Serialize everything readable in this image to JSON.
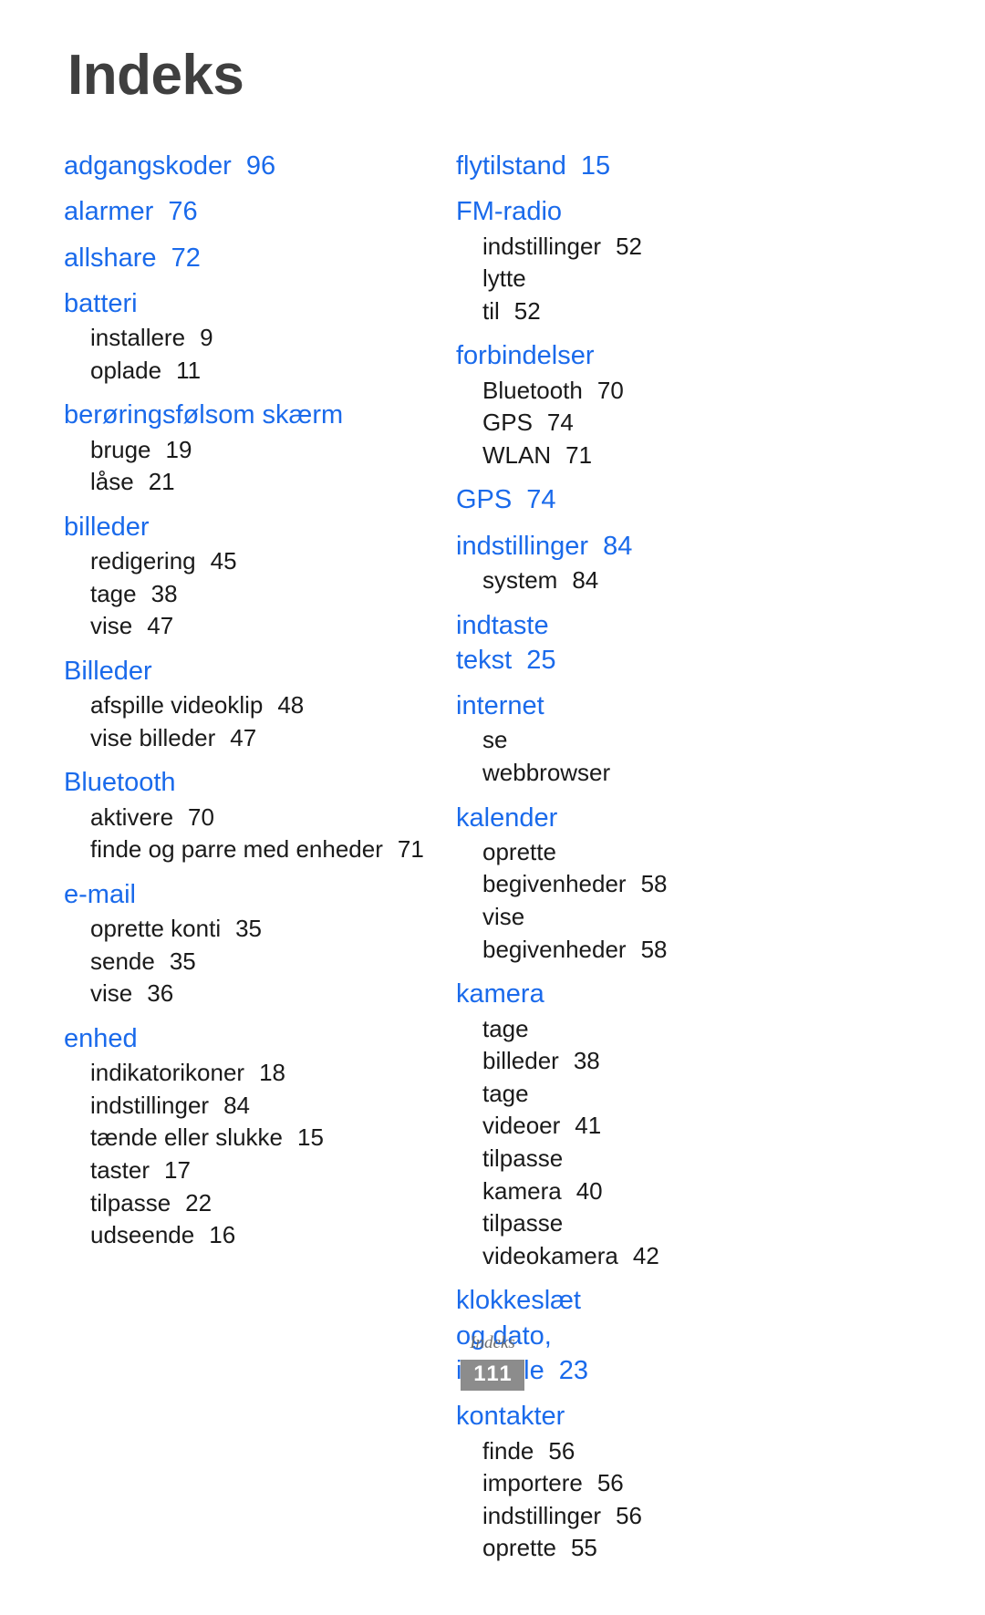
{
  "document": {
    "title": "Indeks",
    "footer_label": "Indeks",
    "page_number": "111",
    "heading_color": "#1a6aeb",
    "subentry_color": "#1a1a1a",
    "title_color": "#3f3f3f",
    "badge_color": "#8c8c8c"
  },
  "columns": [
    {
      "name": "left",
      "entries": [
        {
          "heading": "adgangskoder",
          "page": "96",
          "subs": []
        },
        {
          "heading": "alarmer",
          "page": "76",
          "subs": []
        },
        {
          "heading": "allshare",
          "page": "72",
          "subs": []
        },
        {
          "heading": "batteri",
          "page": "",
          "subs": [
            {
              "label": "installere",
              "page": "9"
            },
            {
              "label": "oplade",
              "page": "11"
            }
          ]
        },
        {
          "heading": "berøringsfølsom skærm",
          "page": "",
          "subs": [
            {
              "label": "bruge",
              "page": "19"
            },
            {
              "label": "låse",
              "page": "21"
            }
          ]
        },
        {
          "heading": "billeder",
          "page": "",
          "subs": [
            {
              "label": "redigering",
              "page": "45"
            },
            {
              "label": "tage",
              "page": "38"
            },
            {
              "label": "vise",
              "page": "47"
            }
          ]
        },
        {
          "heading": "Billeder",
          "page": "",
          "subs": [
            {
              "label": "afspille videoklip",
              "page": "48"
            },
            {
              "label": "vise billeder",
              "page": "47"
            }
          ]
        },
        {
          "heading": "Bluetooth",
          "page": "",
          "subs": [
            {
              "label": "aktivere",
              "page": "70"
            },
            {
              "label": "finde og parre med enheder",
              "page": "71"
            }
          ]
        },
        {
          "heading": "e-mail",
          "page": "",
          "subs": [
            {
              "label": "oprette konti",
              "page": "35"
            },
            {
              "label": "sende",
              "page": "35"
            },
            {
              "label": "vise",
              "page": "36"
            }
          ]
        },
        {
          "heading": "enhed",
          "page": "",
          "subs": [
            {
              "label": "indikatorikoner",
              "page": "18"
            },
            {
              "label": "indstillinger",
              "page": "84"
            },
            {
              "label": "tænde eller slukke",
              "page": "15"
            },
            {
              "label": "taster",
              "page": "17"
            },
            {
              "label": "tilpasse",
              "page": "22"
            },
            {
              "label": "udseende",
              "page": "16"
            }
          ]
        }
      ]
    },
    {
      "name": "right",
      "entries": [
        {
          "heading": "flytilstand",
          "page": "15",
          "subs": []
        },
        {
          "heading": "FM-radio",
          "page": "",
          "subs": [
            {
              "label": "indstillinger",
              "page": "52"
            },
            {
              "label": "lytte til",
              "page": "52"
            }
          ]
        },
        {
          "heading": "forbindelser",
          "page": "",
          "subs": [
            {
              "label": "Bluetooth",
              "page": "70"
            },
            {
              "label": "GPS",
              "page": "74"
            },
            {
              "label": "WLAN",
              "page": "71"
            }
          ]
        },
        {
          "heading": "GPS",
          "page": "74",
          "subs": []
        },
        {
          "heading": "indstillinger",
          "page": "84",
          "subs": [
            {
              "label": "system",
              "page": "84"
            }
          ]
        },
        {
          "heading": "indtaste tekst",
          "page": "25",
          "subs": []
        },
        {
          "heading": "internet",
          "page": "",
          "subs": [
            {
              "label": "se webbrowser",
              "page": ""
            }
          ]
        },
        {
          "heading": "kalender",
          "page": "",
          "subs": [
            {
              "label": "oprette begivenheder",
              "page": "58"
            },
            {
              "label": "vise begivenheder",
              "page": "58"
            }
          ]
        },
        {
          "heading": "kamera",
          "page": "",
          "subs": [
            {
              "label": "tage billeder",
              "page": "38"
            },
            {
              "label": "tage videoer",
              "page": "41"
            },
            {
              "label": "tilpasse kamera",
              "page": "40"
            },
            {
              "label": "tilpasse videokamera",
              "page": "42"
            }
          ]
        },
        {
          "heading": "klokkeslæt og dato, indstille",
          "page": "23",
          "subs": []
        },
        {
          "heading": "kontakter",
          "page": "",
          "subs": [
            {
              "label": "finde",
              "page": "56"
            },
            {
              "label": "importere",
              "page": "56"
            },
            {
              "label": "indstillinger",
              "page": "56"
            },
            {
              "label": "oprette",
              "page": "55"
            }
          ]
        }
      ]
    }
  ]
}
